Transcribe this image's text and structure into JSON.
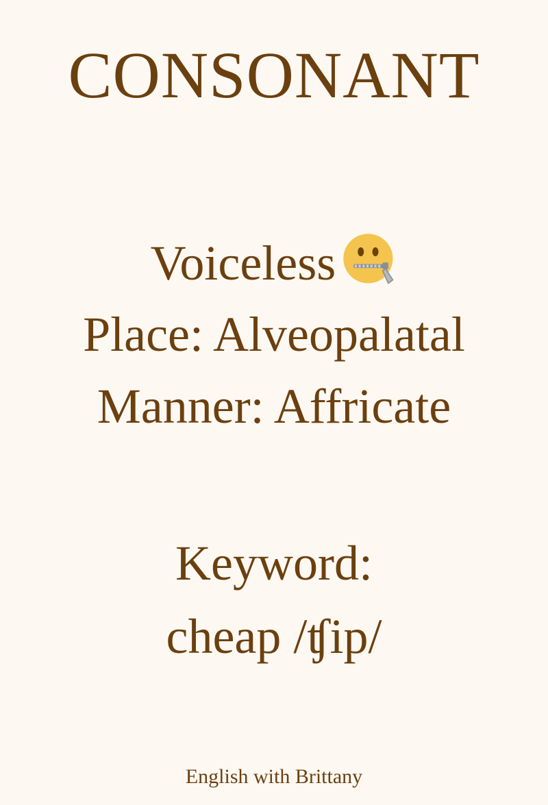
{
  "card": {
    "title": "CONSONANT",
    "voicing": "Voiceless",
    "voicing_icon": "zipper-mouth-face-icon",
    "place": "Place: Alveopalatal",
    "manner": "Manner: Affricate",
    "keyword_label": "Keyword:",
    "keyword_example": "cheap /ʧip/",
    "footer": "English with Brittany"
  },
  "colors": {
    "background": "#fdf8f2",
    "text": "#6b400f",
    "emoji_face": "#f4c44e"
  }
}
